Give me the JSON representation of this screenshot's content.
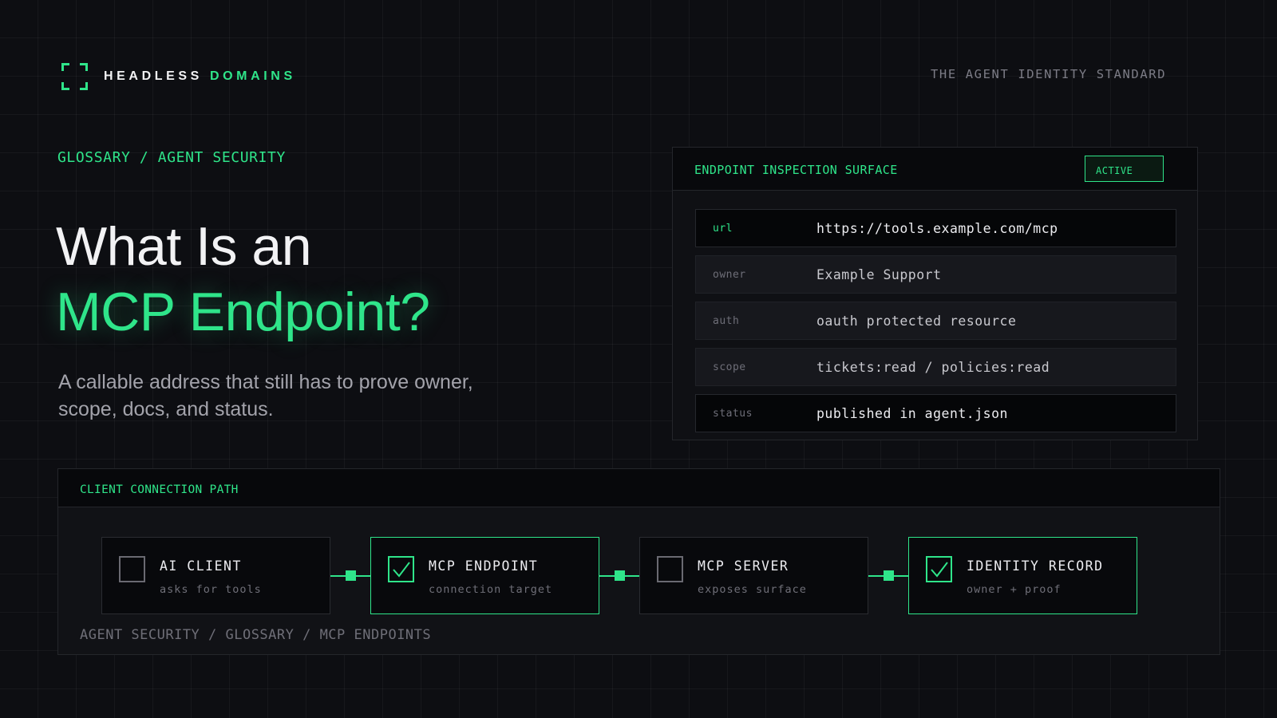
{
  "brand": {
    "name_primary": "HEADLESS",
    "name_accent": "DOMAINS",
    "tagline": "THE AGENT IDENTITY STANDARD"
  },
  "hero": {
    "breadcrumb": "GLOSSARY / AGENT SECURITY",
    "title_line1": "What Is an",
    "title_line2": "MCP Endpoint?",
    "lead": "A callable address that still has to prove owner, scope, docs, and status."
  },
  "inspection": {
    "title": "ENDPOINT INSPECTION SURFACE",
    "badge": "ACTIVE",
    "rows": [
      {
        "key": "url",
        "value": "https://tools.example.com/mcp"
      },
      {
        "key": "owner",
        "value": "Example Support"
      },
      {
        "key": "auth",
        "value": "oauth protected resource"
      },
      {
        "key": "scope",
        "value": "tickets:read / policies:read"
      },
      {
        "key": "status",
        "value": "published in agent.json"
      }
    ]
  },
  "connection": {
    "title": "CLIENT CONNECTION PATH",
    "nodes": [
      {
        "title": "AI CLIENT",
        "subtitle": "asks for tools",
        "checked": false
      },
      {
        "title": "MCP ENDPOINT",
        "subtitle": "connection target",
        "checked": true
      },
      {
        "title": "MCP SERVER",
        "subtitle": "exposes surface",
        "checked": false
      },
      {
        "title": "IDENTITY RECORD",
        "subtitle": "owner + proof",
        "checked": true
      }
    ],
    "footer": "AGENT SECURITY / GLOSSARY / MCP ENDPOINTS"
  },
  "colors": {
    "accent": "#2fe58a",
    "background": "#0d0e12"
  },
  "icons": {
    "brand": "bracket-frame-icon",
    "checked": "checkbox-checked-icon",
    "unchecked": "checkbox-empty-icon"
  }
}
